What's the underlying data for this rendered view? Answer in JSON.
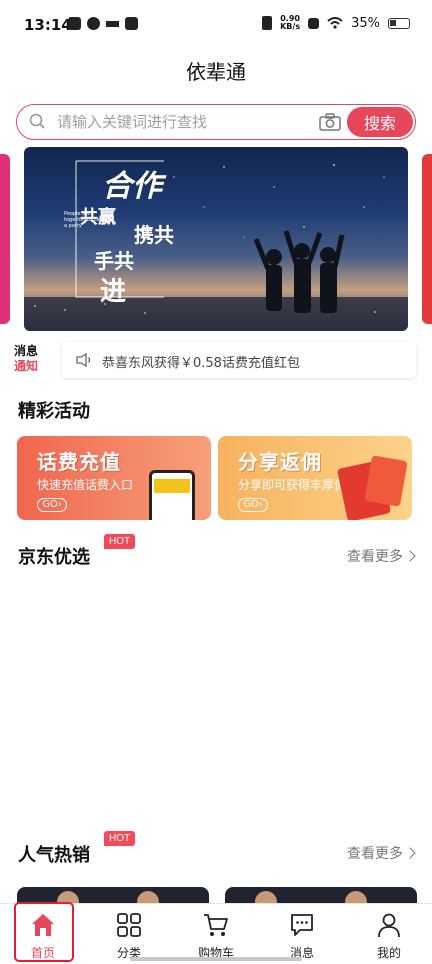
{
  "status_bar": {
    "time": "13:14",
    "net_speed_value": "0.90",
    "net_speed_unit": "KB/s",
    "battery": "35%"
  },
  "header": {
    "title": "依辈通"
  },
  "search": {
    "placeholder": "请输入关键词进行查找",
    "button_label": "搜索"
  },
  "banner": {
    "title_big": "合作",
    "title_lines": [
      "共赢",
      "携共",
      "手共",
      "进"
    ],
    "caption_en": "People are together to call a party"
  },
  "notice": {
    "logo_line1": "消息",
    "logo_line2": "通知",
    "text": "恭喜东风获得￥0.58话费充值红包"
  },
  "activities": {
    "title": "精彩活动",
    "cards": [
      {
        "title": "话费充值",
        "subtitle": "快速充值话费入口",
        "go": "GO"
      },
      {
        "title": "分享返佣",
        "subtitle": "分享即可获得丰厚佣金",
        "go": "GO"
      }
    ]
  },
  "jd_section": {
    "title": "京东优选",
    "badge": "HOT",
    "more": "查看更多"
  },
  "popular_section": {
    "title": "人气热销",
    "badge": "HOT",
    "more": "查看更多"
  },
  "tabs": [
    {
      "label": "首页",
      "icon": "home-icon",
      "active": true
    },
    {
      "label": "分类",
      "icon": "grid-icon",
      "active": false
    },
    {
      "label": "购物车",
      "icon": "cart-icon",
      "active": false
    },
    {
      "label": "消息",
      "icon": "chat-icon",
      "active": false
    },
    {
      "label": "我的",
      "icon": "user-icon",
      "active": false
    }
  ],
  "colors": {
    "accent": "#e8475b",
    "active_frame": "#e21f2e"
  }
}
